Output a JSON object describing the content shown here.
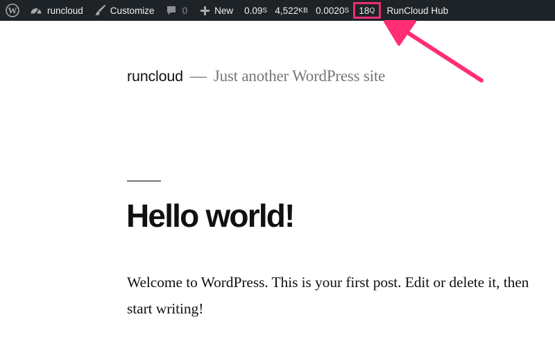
{
  "adminbar": {
    "wp_logo_icon": "wordpress-logo-icon",
    "site_name": "runcloud",
    "customize_label": "Customize",
    "comments_count": "0",
    "new_label": "New",
    "qm": {
      "time_value": "0.09",
      "time_unit": "S",
      "memory_value": "4,522",
      "memory_unit": "KB",
      "db_time_value": "0.0020",
      "db_time_unit": "S",
      "queries_value": "18",
      "queries_unit": "Q"
    },
    "hub_label": "RunCloud Hub",
    "colors": {
      "background": "#1d2327",
      "text": "#f0f0f1",
      "highlight_border": "#ee2d74"
    }
  },
  "site": {
    "title": "runcloud",
    "separator": "—",
    "description": "Just another WordPress site"
  },
  "post": {
    "title": "Hello world!",
    "excerpt": "Welcome to WordPress. This is your first post. Edit or delete it, then start writing!"
  },
  "annotation": {
    "arrow_color": "#ff2e74",
    "target": "queries-count"
  }
}
